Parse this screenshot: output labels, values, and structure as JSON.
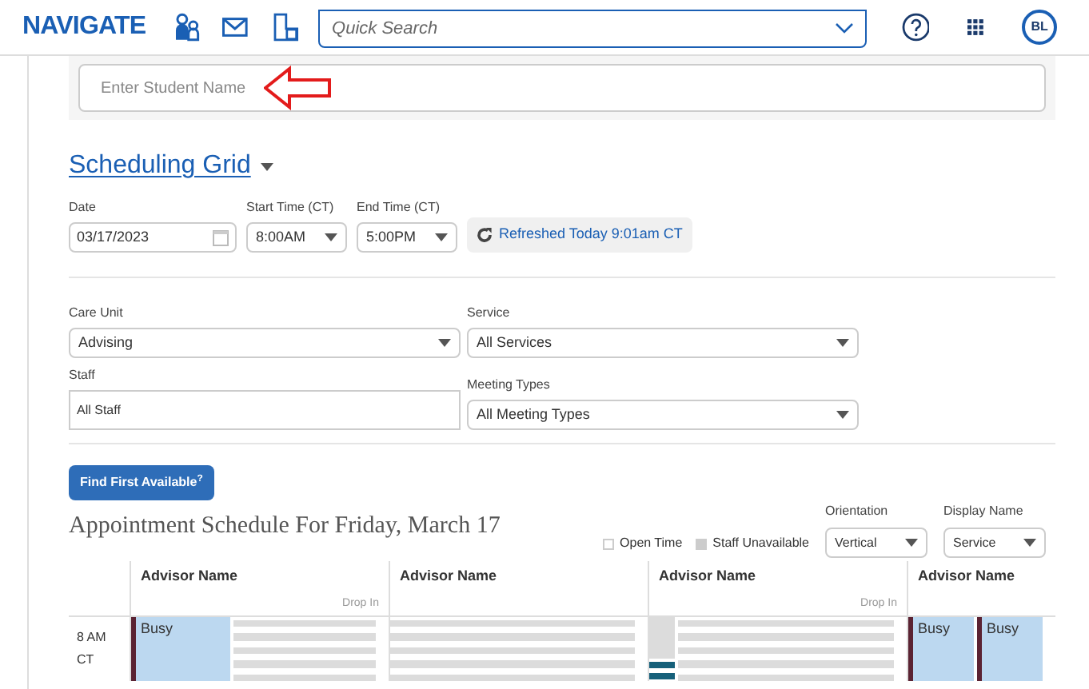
{
  "header": {
    "brand": "NAVIGATE",
    "search_placeholder": "Quick Search",
    "avatar": "BL"
  },
  "student_search": {
    "placeholder": "Enter Student Name"
  },
  "view_title": "Scheduling Grid",
  "date_filters": [
    {
      "kind": "date",
      "label": "Date",
      "value": "03/17/2023"
    },
    {
      "kind": "select",
      "label": "Start Time (CT)",
      "value": "8:00AM"
    },
    {
      "kind": "select",
      "label": "End Time (CT)",
      "value": "5:00PM"
    }
  ],
  "refresh_status": "Refreshed Today 9:01am CT",
  "filters": [
    {
      "kind": "select",
      "label": "Care Unit",
      "value": "Advising"
    },
    {
      "kind": "select",
      "label": "Service",
      "value": "All Services"
    },
    {
      "kind": "text",
      "label": "Staff",
      "value": "All Staff"
    },
    {
      "kind": "select",
      "label": "Meeting Types",
      "value": "All Meeting Types"
    }
  ],
  "find_button": "Find First Available$^{?}$",
  "schedule_title": "Appointment Schedule For Friday, March 17",
  "legend": [
    {
      "kind": "open",
      "label": "Open Time"
    },
    {
      "kind": "unavailable",
      "label": "Staff Unavailable"
    }
  ],
  "orientation": {
    "label": "Orientation",
    "value": "Vertical"
  },
  "display_name": {
    "label": "Display Name",
    "value": "Service"
  },
  "time_label": "8 AM CT",
  "columns": [
    {
      "header": "Advisor Name",
      "tag": "Drop In",
      "lanes": [
        {
          "kind": "busy",
          "label": "Busy"
        }
      ]
    },
    {
      "header": "Advisor Name"
    },
    {
      "header": "Advisor Name",
      "tag": "Drop In",
      "lanes": [
        {
          "kind": "unavailable"
        }
      ]
    },
    {
      "header": "Advisor Name",
      "lanes": [
        {
          "kind": "busy",
          "label": "Busy"
        },
        {
          "kind": "busy",
          "label": "Busy"
        }
      ]
    }
  ]
}
